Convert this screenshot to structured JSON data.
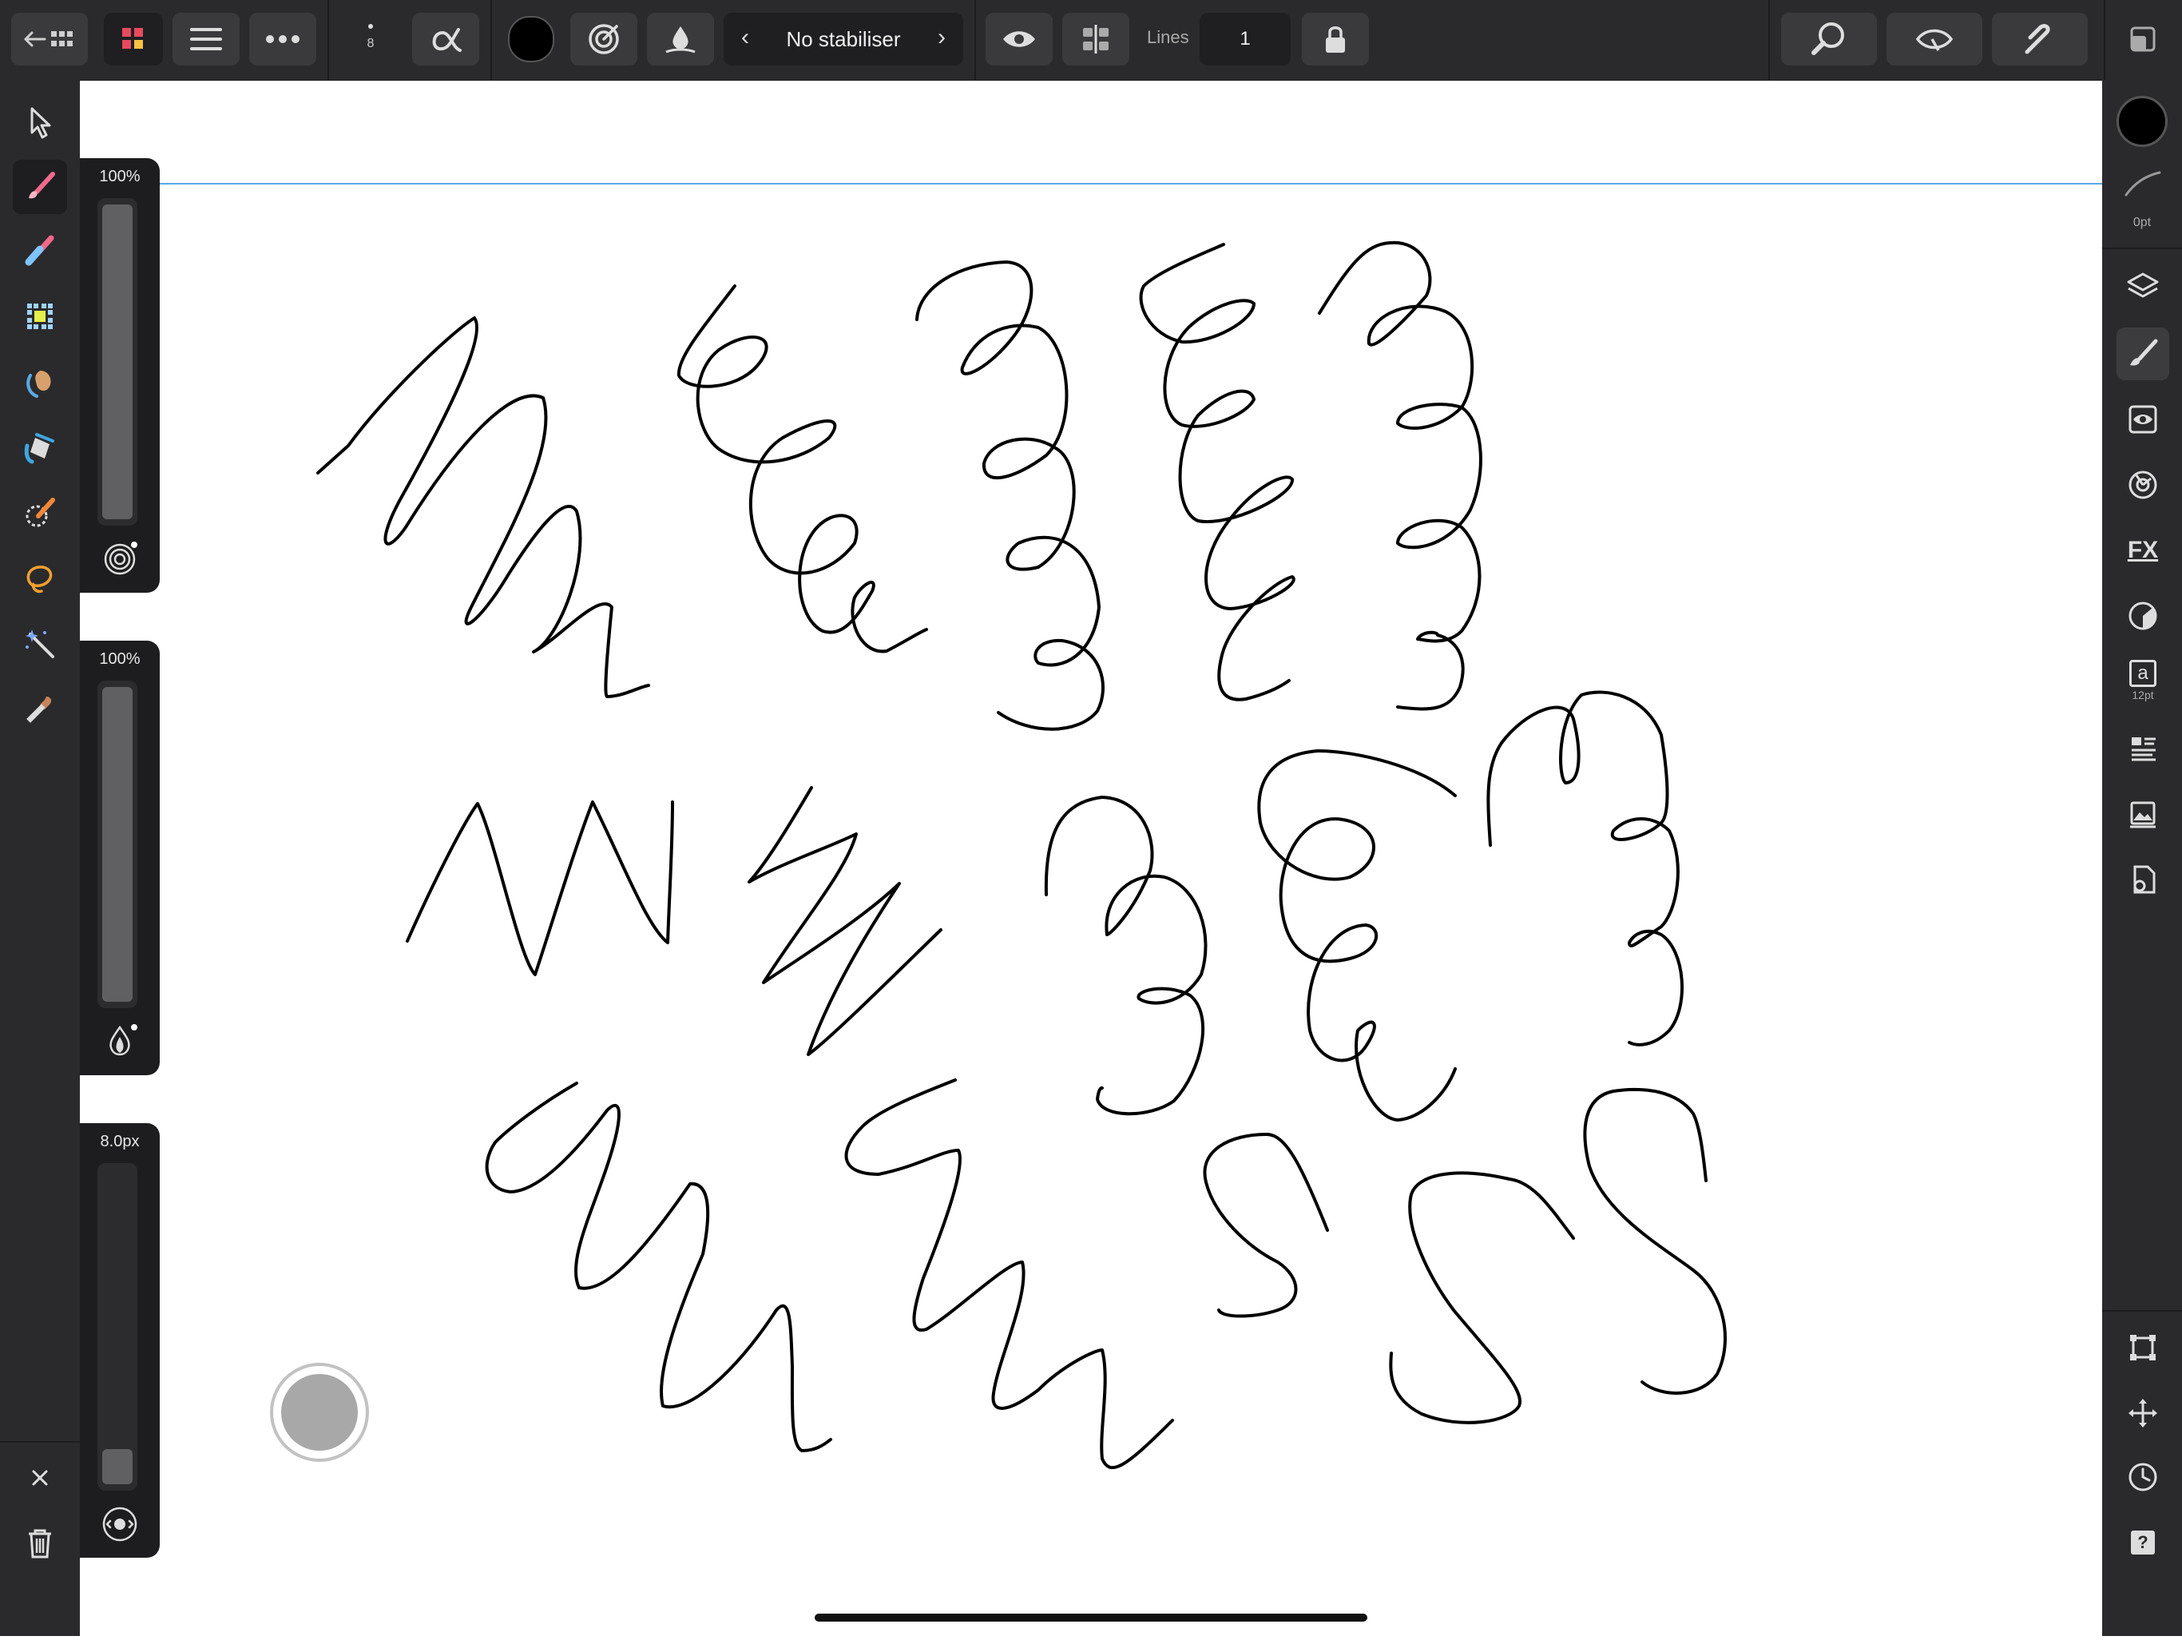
{
  "toolbar": {
    "brush_size_value": "8",
    "stabiliser_label": "No stabiliser",
    "lines_label": "Lines",
    "lines_value": "1",
    "primary_color": "#000000"
  },
  "left_panels": {
    "opacity_value": "100%",
    "opacity_level": 1.0,
    "flow_value": "100%",
    "flow_level": 1.0,
    "width_value": "8.0px",
    "width_level": 0.08
  },
  "right_panel": {
    "stroke_width_label": "0pt",
    "text_size_label": "12pt",
    "text_icon_glyph": "a",
    "fx_glyph": "FX",
    "help_glyph": "?"
  },
  "icons": {
    "back": "back-arrow-icon",
    "grid": "grid-icon",
    "persona": "persona-icon",
    "menu": "hamburger-menu-icon",
    "more": "more-dots-icon",
    "alpha": "alpha-icon",
    "color": "color-swatch-icon",
    "assistant": "assistant-icon",
    "wet_edges": "wet-edges-icon",
    "eye": "eye-icon",
    "symmetry": "symmetry-icon",
    "lock": "lock-icon",
    "zoom": "zoom-icon",
    "view": "view-mode-icon",
    "snap": "snapping-icon",
    "fullscreen": "fullscreen-icon",
    "move_tool": "move-tool-icon",
    "paint_brush": "paint-brush-icon",
    "erase_brush": "erase-brush-icon",
    "pixel": "pixel-tool-icon",
    "smudge": "smudge-tool-icon",
    "flood_fill": "flood-fill-icon",
    "selection_brush": "selection-brush-icon",
    "freehand_selection": "freehand-selection-icon",
    "magic_wand": "magic-wand-icon",
    "color_picker": "color-picker-icon"
  }
}
